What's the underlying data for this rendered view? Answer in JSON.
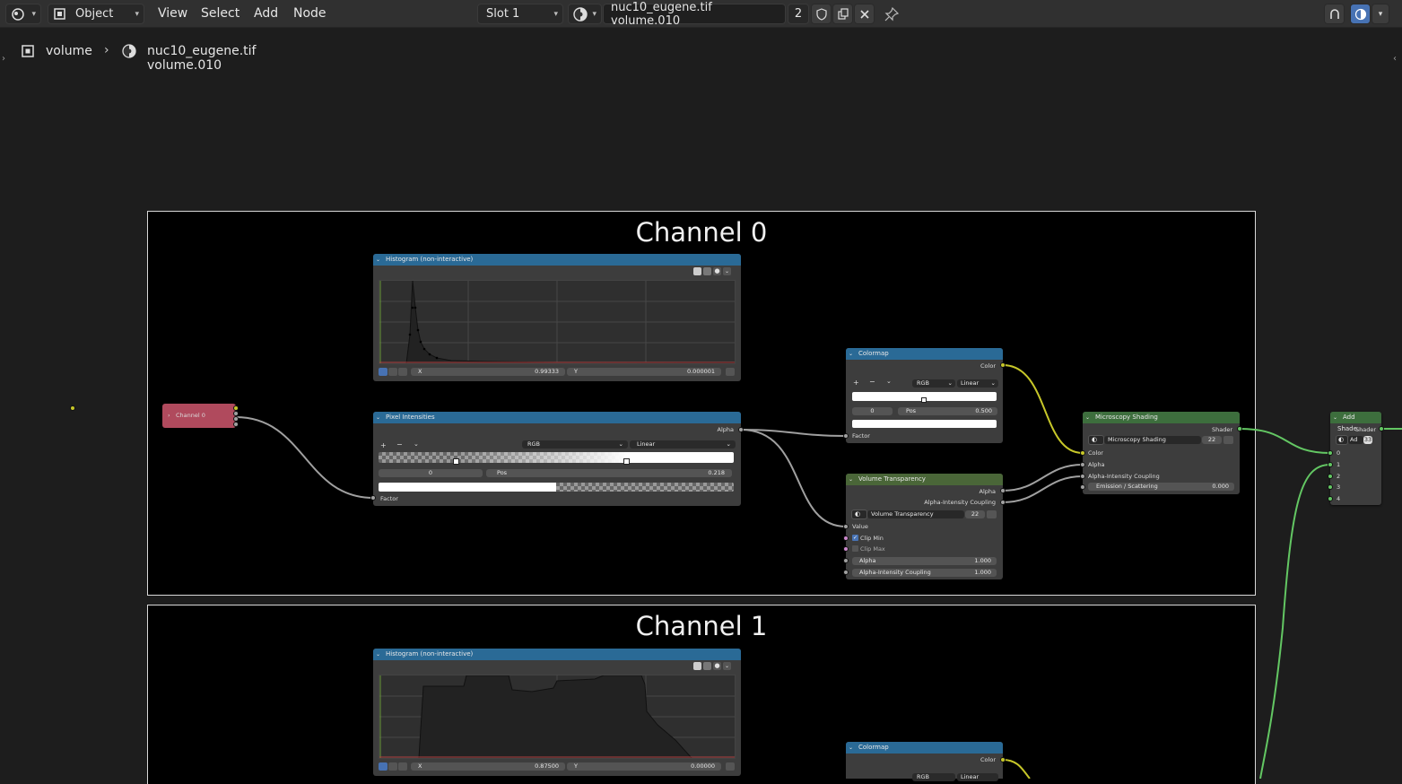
{
  "header": {
    "mode": "Object",
    "menus": [
      "View",
      "Select",
      "Add",
      "Node"
    ],
    "slot": "Slot 1",
    "material_name": "nuc10_eugene.tif volume.010",
    "user_count": "2"
  },
  "breadcrumb": {
    "object": "volume",
    "material": "nuc10_eugene.tif volume.010"
  },
  "frames": {
    "channel0": "Channel 0",
    "channel1": "Channel 1"
  },
  "nodes": {
    "channel0_group": {
      "title": "Channel 0"
    },
    "histogram0": {
      "title": "Histogram (non-interactive)",
      "x_label": "X",
      "x_value": "0.99333",
      "y_label": "Y",
      "y_value": "0.000001"
    },
    "pixel_intensities": {
      "title": "Pixel Intensities",
      "out_alpha": "Alpha",
      "color_mode": "RGB",
      "interpolation": "Linear",
      "stop_index": "0",
      "pos_label": "Pos",
      "pos_value": "0.218",
      "in_factor": "Factor"
    },
    "colormap0": {
      "title": "Colormap",
      "out_color": "Color",
      "color_mode": "RGB",
      "interpolation": "Linear",
      "stop_index": "0",
      "pos_label": "Pos",
      "pos_value": "0.500",
      "in_factor": "Factor"
    },
    "volume_transparency": {
      "title": "Volume Transparency",
      "out_alpha": "Alpha",
      "out_coupling": "Alpha-Intensity Coupling",
      "group_name": "Volume Transparency",
      "group_users": "22",
      "in_value": "Value",
      "clip_min": "Clip Min",
      "clip_max": "Clip Max",
      "alpha_label": "Alpha",
      "alpha_value": "1.000",
      "coupling_label": "Alpha-Intensity Coupling",
      "coupling_value": "1.000"
    },
    "microscopy_shading": {
      "title": "Microscopy Shading",
      "out_shader": "Shader",
      "group_name": "Microscopy Shading",
      "group_users": "22",
      "in_color": "Color",
      "in_alpha": "Alpha",
      "in_coupling": "Alpha-Intensity Coupling",
      "emission_label": "Emission / Scattering",
      "emission_value": "0.000"
    },
    "add_shader": {
      "title": "Add Shade...",
      "out_shader": "Shader",
      "group_name": "Ad",
      "group_users": "33",
      "inputs": [
        "0",
        "1",
        "2",
        "3",
        "4"
      ]
    },
    "histogram1": {
      "title": "Histogram (non-interactive)",
      "x_label": "X",
      "x_value": "0.87500",
      "y_label": "Y",
      "y_value": "0.00000"
    },
    "colormap1": {
      "title": "Colormap",
      "out_color": "Color",
      "color_mode": "RGB",
      "interpolation": "Linear"
    }
  },
  "colors": {
    "header_bg": "#303030",
    "editor_bg": "#1d1d1d",
    "node_body": "#3d3d3d",
    "group_header_blue": "#2a6a96",
    "shader_header_green": "#3d6e3d",
    "socket_float": "#a1a1a1",
    "socket_color": "#c7c729",
    "socket_shader": "#63c763",
    "channel_node": "#b04a5d"
  }
}
